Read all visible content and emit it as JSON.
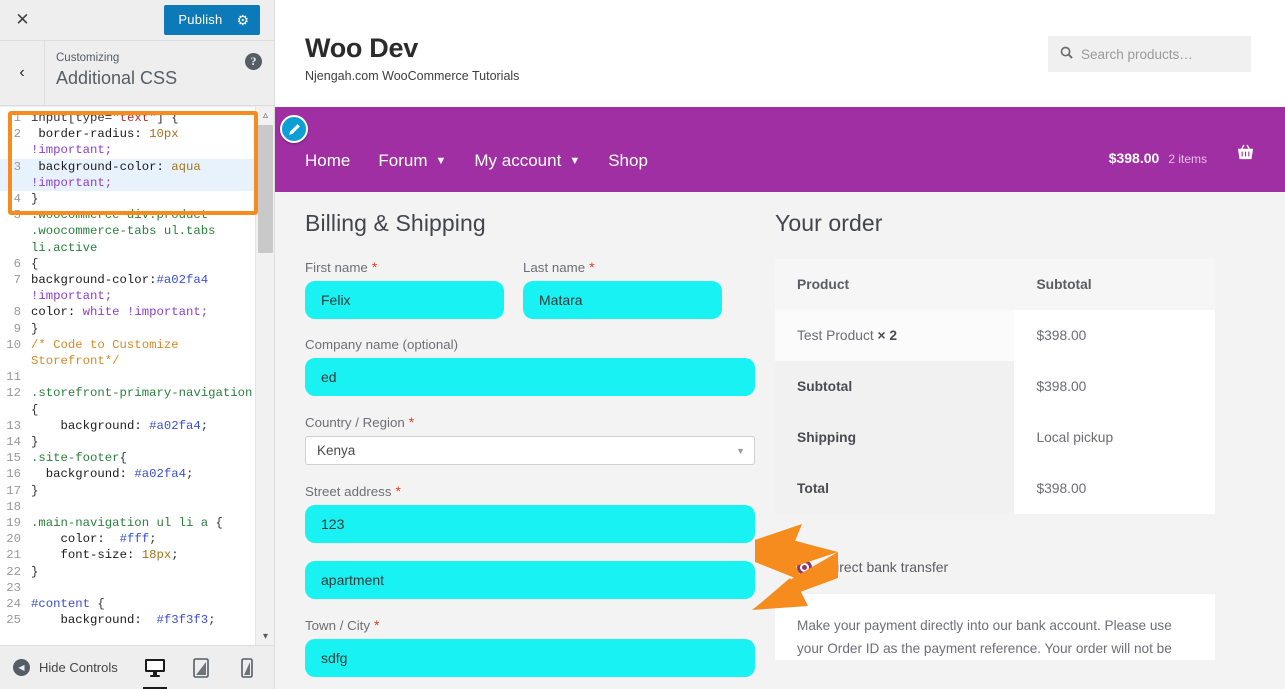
{
  "customizer": {
    "close_label": "✕",
    "publish_label": "Publish",
    "gear_icon": "gear-icon",
    "back_label": "‹",
    "breadcrumb": "Customizing",
    "panel_title": "Additional CSS",
    "help_label": "?",
    "hide_controls_label": "Hide Controls",
    "devices": [
      {
        "name": "desktop",
        "glyph": "🖥",
        "active": true
      },
      {
        "name": "tablet",
        "glyph": "▯",
        "active": false
      },
      {
        "name": "mobile",
        "glyph": "▯",
        "active": false
      }
    ],
    "highlight_color": "#f68b1e",
    "publish_color": "#0c7ab8"
  },
  "code_editor": {
    "highlighted_lines": [
      1,
      2,
      3,
      4
    ],
    "active_line": 3,
    "lines": [
      {
        "n": "1",
        "tokens": [
          {
            "t": "input[type=",
            "c": "tk-plain"
          },
          {
            "t": "\"text\"",
            "c": "tk-str"
          },
          {
            "t": "] {",
            "c": "tk-plain"
          }
        ]
      },
      {
        "n": "2",
        "tokens": [
          {
            "t": " border-radius: ",
            "c": "tk-prop"
          },
          {
            "t": "10px",
            "c": "tk-num"
          },
          {
            "t": "\n",
            "c": "tk-plain"
          },
          {
            "t": "!important;",
            "c": "tk-imp"
          }
        ]
      },
      {
        "n": "3",
        "tokens": [
          {
            "t": " background-color: ",
            "c": "tk-prop"
          },
          {
            "t": "aqua",
            "c": "tk-val"
          },
          {
            "t": "\n",
            "c": "tk-plain"
          },
          {
            "t": "!important;",
            "c": "tk-imp"
          }
        ]
      },
      {
        "n": "4",
        "tokens": [
          {
            "t": "}",
            "c": "tk-plain"
          }
        ]
      },
      {
        "n": "5",
        "tokens": [
          {
            "t": ".woocommerce div.product\n.woocommerce-tabs ul.tabs\nli.active",
            "c": "tk-sel"
          }
        ]
      },
      {
        "n": "6",
        "tokens": [
          {
            "t": "{",
            "c": "tk-plain"
          }
        ]
      },
      {
        "n": "7",
        "tokens": [
          {
            "t": "background-color:",
            "c": "tk-prop"
          },
          {
            "t": "#a02fa4",
            "c": "tk-hash"
          },
          {
            "t": "\n",
            "c": "tk-plain"
          },
          {
            "t": "!important;",
            "c": "tk-imp"
          }
        ]
      },
      {
        "n": "8",
        "tokens": [
          {
            "t": "color: ",
            "c": "tk-prop"
          },
          {
            "t": "white",
            "c": "tk-kw"
          },
          {
            "t": " ",
            "c": "tk-plain"
          },
          {
            "t": "!important;",
            "c": "tk-imp"
          }
        ]
      },
      {
        "n": "9",
        "tokens": [
          {
            "t": "}",
            "c": "tk-plain"
          }
        ]
      },
      {
        "n": "10",
        "tokens": [
          {
            "t": "/* Code to Customize\nStorefront*/",
            "c": "tk-cmt"
          }
        ]
      },
      {
        "n": "11",
        "tokens": [
          {
            "t": "",
            "c": "tk-plain"
          }
        ]
      },
      {
        "n": "12",
        "tokens": [
          {
            "t": ".storefront-primary-navigation",
            "c": "tk-sel"
          },
          {
            "t": "\n{",
            "c": "tk-plain"
          }
        ]
      },
      {
        "n": "13",
        "tokens": [
          {
            "t": "    background: ",
            "c": "tk-prop"
          },
          {
            "t": "#a02fa4",
            "c": "tk-hash"
          },
          {
            "t": ";",
            "c": "tk-plain"
          }
        ]
      },
      {
        "n": "14",
        "tokens": [
          {
            "t": "}",
            "c": "tk-plain"
          }
        ]
      },
      {
        "n": "15",
        "tokens": [
          {
            "t": ".site-footer",
            "c": "tk-sel"
          },
          {
            "t": "{",
            "c": "tk-plain"
          }
        ]
      },
      {
        "n": "16",
        "tokens": [
          {
            "t": "  background: ",
            "c": "tk-prop"
          },
          {
            "t": "#a02fa4",
            "c": "tk-hash"
          },
          {
            "t": ";",
            "c": "tk-plain"
          }
        ]
      },
      {
        "n": "17",
        "tokens": [
          {
            "t": "}",
            "c": "tk-plain"
          }
        ]
      },
      {
        "n": "18",
        "tokens": [
          {
            "t": "",
            "c": "tk-plain"
          }
        ]
      },
      {
        "n": "19",
        "tokens": [
          {
            "t": ".main-navigation ul li a",
            "c": "tk-sel"
          },
          {
            "t": " {",
            "c": "tk-plain"
          }
        ]
      },
      {
        "n": "20",
        "tokens": [
          {
            "t": "    color:  ",
            "c": "tk-prop"
          },
          {
            "t": "#fff",
            "c": "tk-hash"
          },
          {
            "t": ";",
            "c": "tk-plain"
          }
        ]
      },
      {
        "n": "21",
        "tokens": [
          {
            "t": "    font-size: ",
            "c": "tk-prop"
          },
          {
            "t": "18px",
            "c": "tk-num"
          },
          {
            "t": ";",
            "c": "tk-plain"
          }
        ]
      },
      {
        "n": "22",
        "tokens": [
          {
            "t": "}",
            "c": "tk-plain"
          }
        ]
      },
      {
        "n": "23",
        "tokens": [
          {
            "t": "",
            "c": "tk-plain"
          }
        ]
      },
      {
        "n": "24",
        "tokens": [
          {
            "t": "#content",
            "c": "tk-hash"
          },
          {
            "t": " {",
            "c": "tk-plain"
          }
        ]
      },
      {
        "n": "25",
        "tokens": [
          {
            "t": "    background:  ",
            "c": "tk-prop"
          },
          {
            "t": "#f3f3f3",
            "c": "tk-hash"
          },
          {
            "t": ";",
            "c": "tk-plain"
          }
        ]
      }
    ]
  },
  "site": {
    "brand_title": "Woo Dev",
    "brand_tagline": "Njengah.com WooCommerce Tutorials",
    "search_placeholder": "Search products…",
    "search_icon": "search-icon",
    "nav_color": "#a02fa4",
    "nav": [
      {
        "label": "Home",
        "caret": false
      },
      {
        "label": "Forum",
        "caret": true
      },
      {
        "label": "My account",
        "caret": true
      },
      {
        "label": "Shop",
        "caret": false
      }
    ],
    "cart_amount": "$398.00",
    "cart_count": "2 items",
    "cart_icon": "basket-icon",
    "edit_icon": "pencil-edit-icon"
  },
  "billing": {
    "heading": "Billing & Shipping",
    "first_name": {
      "label": "First name",
      "required": true,
      "value": "Felix"
    },
    "last_name": {
      "label": "Last name",
      "required": true,
      "value": "Matara"
    },
    "company": {
      "label": "Company name (optional)",
      "required": false,
      "value": "ed"
    },
    "country": {
      "label": "Country / Region",
      "required": true,
      "value": "Kenya"
    },
    "street": {
      "label": "Street address",
      "required": true,
      "value": "123"
    },
    "street2": {
      "label": "",
      "required": false,
      "value": "apartment"
    },
    "town": {
      "label": "Town / City",
      "required": true,
      "value": "sdfg"
    },
    "required_mark": "*",
    "input_bg": "#19f2f2"
  },
  "order": {
    "heading": "Your order",
    "columns": [
      "Product",
      "Subtotal"
    ],
    "line_items": [
      {
        "name": "Test Product",
        "qty": "× 2",
        "amount": "$398.00"
      }
    ],
    "totals": [
      {
        "label": "Subtotal",
        "value": "$398.00"
      },
      {
        "label": "Shipping",
        "value": "Local pickup"
      },
      {
        "label": "Total",
        "value": "$398.00"
      }
    ],
    "payment": {
      "selected": "Direct bank transfer",
      "description_line1": "Make your payment directly into our bank account. Please use",
      "description_line2": "your Order ID as the payment reference. Your order will not be"
    }
  }
}
